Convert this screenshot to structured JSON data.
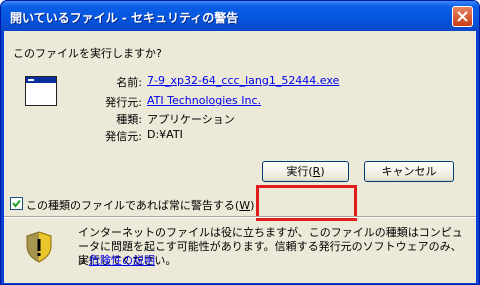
{
  "window": {
    "title": "開いているファイル - セキュリティの警告"
  },
  "prompt": "このファイルを実行しますか?",
  "file": {
    "name_label": "名前:",
    "name_value": "7-9_xp32-64_ccc_lang1_52444.exe",
    "publisher_label": "発行元:",
    "publisher_value": "ATI Technologies Inc.",
    "type_label": "種類:",
    "type_value": "アプリケーション",
    "from_label": "発信元:",
    "from_value": "D:¥ATI"
  },
  "buttons": {
    "run": "実行(R)",
    "run_text": "実行(",
    "run_key": "R",
    "run_close": ")",
    "cancel": "キャンセル"
  },
  "checkbox": {
    "text": "この種類のファイルであれば常に警告する(",
    "key": "W",
    "close": ")",
    "checked": true
  },
  "warning": {
    "text": "インターネットのファイルは役に立ちますが、このファイルの種類はコンピュータに問題を起こす可能性があります。信頼する発行元のソフトウェアのみ、実行してください。",
    "bullet": "▫",
    "risk_link": "危険性の説明"
  },
  "colors": {
    "highlight": "#e01b1b",
    "link": "#0000ee",
    "titlebar": "#0654de"
  }
}
